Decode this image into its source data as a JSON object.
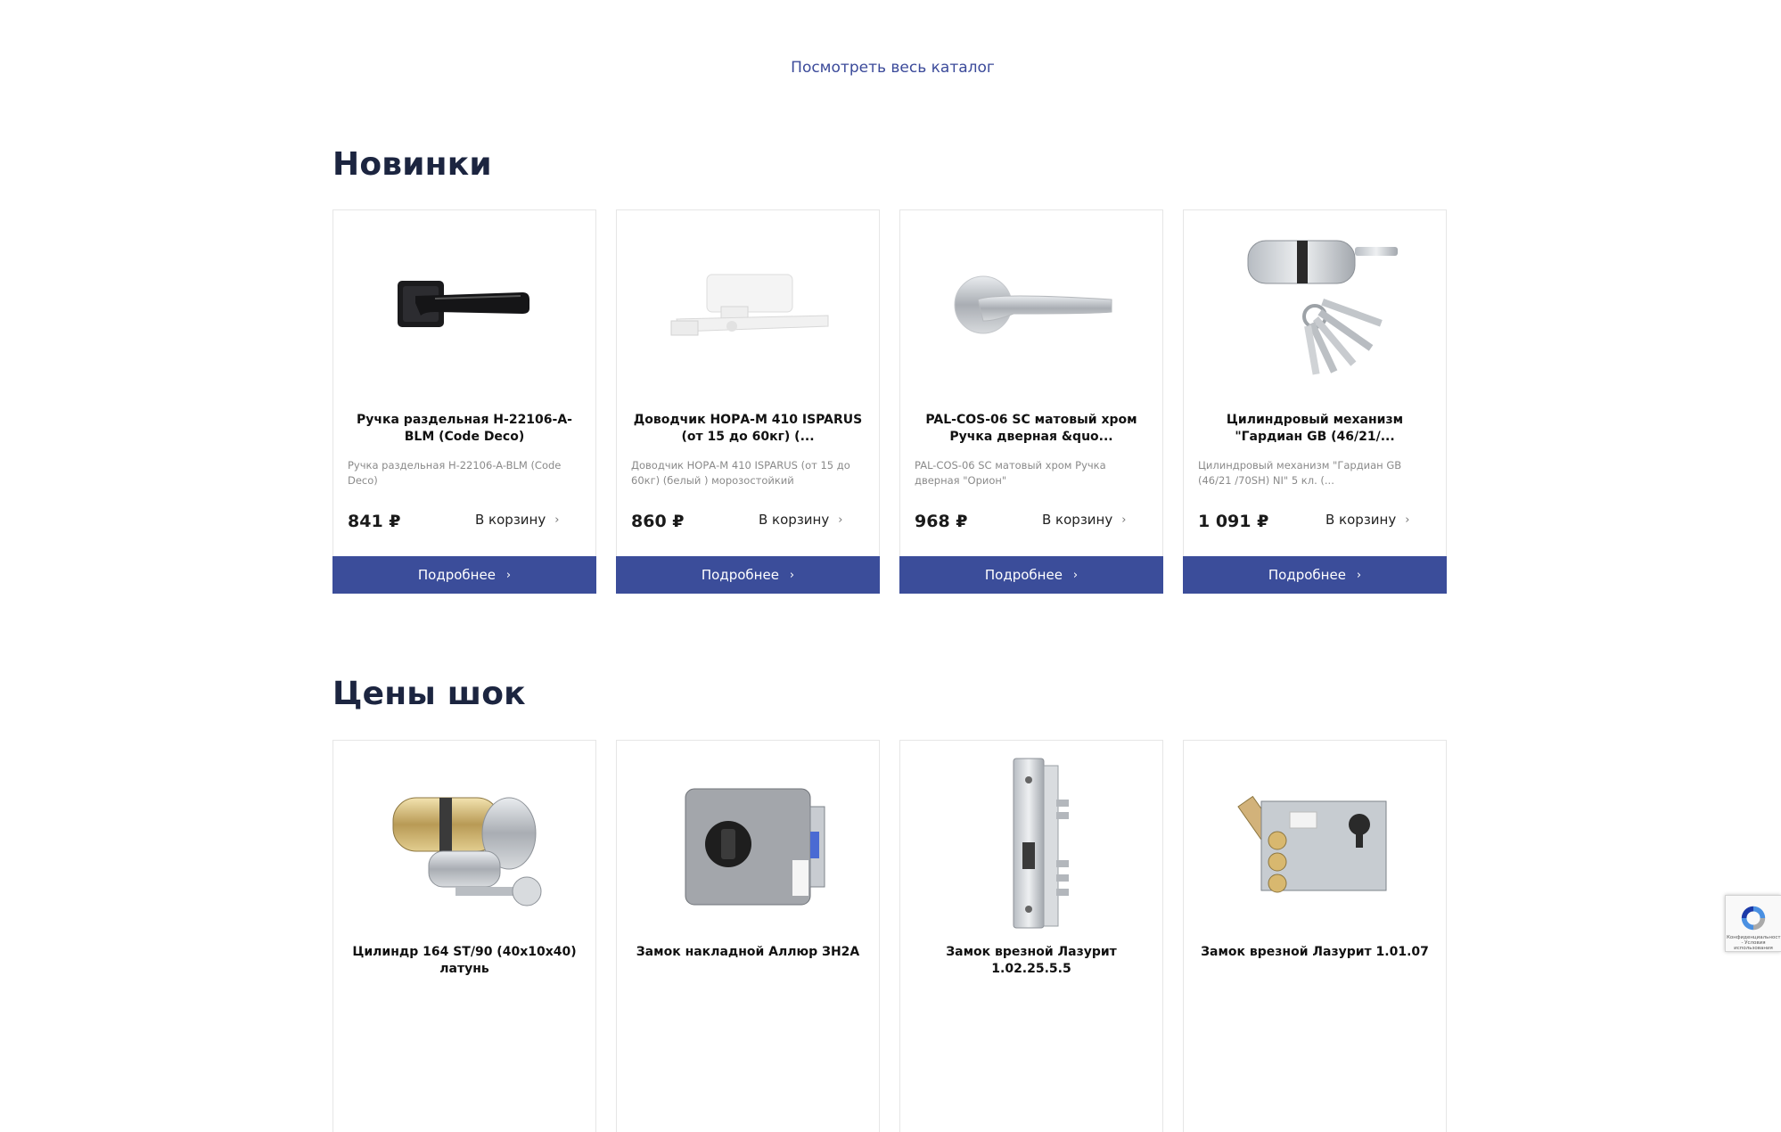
{
  "catalog_link": "Посмотреть весь каталог",
  "sections": [
    {
      "title": "Новинки",
      "products": [
        {
          "title": "Ручка раздельная H-22106-A-BLM (Code Deco)",
          "description": "Ручка раздельная H-22106-A-BLM  (Code Deco)",
          "price": "841 ₽",
          "cart_label": "В корзину",
          "more_label": "Подробнее",
          "image": "door-handle-black"
        },
        {
          "title": "Доводчик НОРА-М 410 ISPARUS (от 15 до 60кг) (...",
          "description": "Доводчик НОРА-М 410 ISPARUS (от 15 до 60кг) (белый ) морозостойкий",
          "price": "860 ₽",
          "cart_label": "В корзину",
          "more_label": "Подробнее",
          "image": "door-closer-white"
        },
        {
          "title": "PAL-COS-06 SC матовый хром Ручка дверная &quo...",
          "description": "PAL-COS-06 SC матовый хром Ручка дверная \"Орион\"",
          "price": "968 ₽",
          "cart_label": "В корзину",
          "more_label": "Подробнее",
          "image": "door-handle-chrome"
        },
        {
          "title": "Цилиндровый механизм \"Гардиан GB (46/21/...",
          "description": "Цилиндровый механизм \"Гардиан GB (46/21 /70SH) NI\"  5 кл. (...",
          "price": "1 091 ₽",
          "cart_label": "В корзину",
          "more_label": "Подробнее",
          "image": "cylinder-with-keys"
        }
      ]
    },
    {
      "title": "Цены шок",
      "products": [
        {
          "title": "Цилиндр 164 ST/90 (40х10х40) латунь",
          "image": "cylinder-brass"
        },
        {
          "title": "Замок накладной Аллюр ЗН2А",
          "image": "rim-lock"
        },
        {
          "title": "Замок врезной Лазурит 1.02.25.5.5",
          "image": "mortise-lock-narrow"
        },
        {
          "title": "Замок врезной Лазурит 1.01.07",
          "image": "mortise-lock-wide"
        }
      ]
    }
  ],
  "recaptcha": {
    "text": "Конфиденциальность - Условия использования"
  }
}
